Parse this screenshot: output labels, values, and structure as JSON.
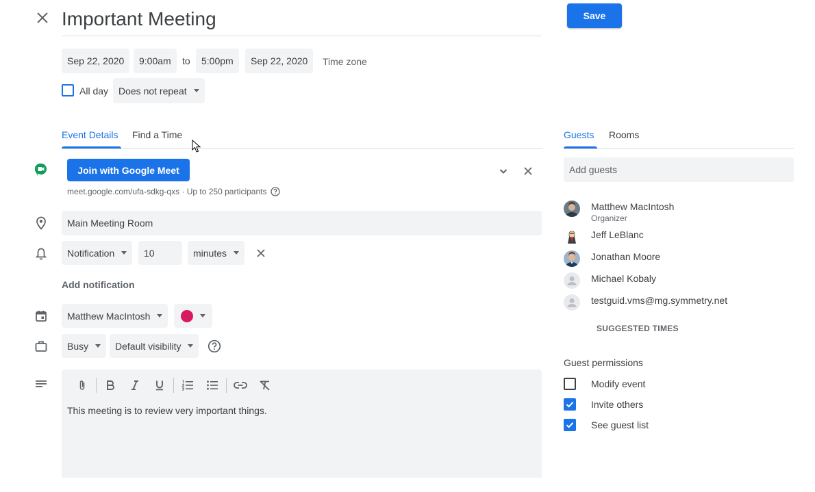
{
  "header": {
    "title": "Important Meeting",
    "save_label": "Save"
  },
  "datetime": {
    "start_date": "Sep 22, 2020",
    "start_time": "9:00am",
    "to_label": "to",
    "end_time": "5:00pm",
    "end_date": "Sep 22, 2020",
    "timezone_label": "Time zone",
    "all_day_label": "All day",
    "all_day_checked": false,
    "repeat": "Does not repeat"
  },
  "tabs": {
    "left": [
      {
        "label": "Event Details",
        "active": true
      },
      {
        "label": "Find a Time",
        "active": false
      }
    ],
    "right": [
      {
        "label": "Guests",
        "active": true
      },
      {
        "label": "Rooms",
        "active": false
      }
    ]
  },
  "meet": {
    "button_label": "Join with Google Meet",
    "info": "meet.google.com/ufa-sdkg-qxs · Up to 250 participants"
  },
  "location": {
    "value": "Main Meeting Room"
  },
  "notification": {
    "type": "Notification",
    "amount": "10",
    "unit": "minutes",
    "add_label": "Add notification"
  },
  "calendar": {
    "owner": "Matthew MacIntosh",
    "color": "#d81b60"
  },
  "availability": {
    "status": "Busy",
    "visibility": "Default visibility"
  },
  "description": {
    "text": "This meeting is to review very important things."
  },
  "guests": {
    "add_placeholder": "Add guests",
    "list": [
      {
        "name": "Matthew MacIntosh",
        "role": "Organizer"
      },
      {
        "name": "Jeff LeBlanc"
      },
      {
        "name": "Jonathan Moore"
      },
      {
        "name": "Michael Kobaly"
      },
      {
        "name": "testguid.vms@mg.symmetry.net"
      }
    ],
    "suggested_times_label": "SUGGESTED TIMES"
  },
  "permissions": {
    "title": "Guest permissions",
    "items": [
      {
        "label": "Modify event",
        "checked": false
      },
      {
        "label": "Invite others",
        "checked": true
      },
      {
        "label": "See guest list",
        "checked": true
      }
    ]
  },
  "colors": {
    "accent": "#1a73e8",
    "field_bg": "#f1f3f4",
    "text": "#3c4043",
    "muted": "#5f6368"
  }
}
